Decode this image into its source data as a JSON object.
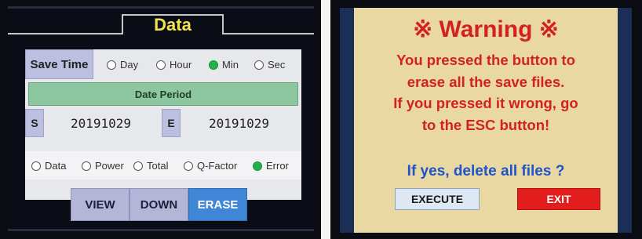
{
  "data_screen": {
    "title": "Data",
    "save_time": {
      "label": "Save Time",
      "options": [
        {
          "label": "Day",
          "selected": false
        },
        {
          "label": "Hour",
          "selected": false
        },
        {
          "label": "Min",
          "selected": true
        },
        {
          "label": "Sec",
          "selected": false
        }
      ]
    },
    "date_period": {
      "label": "Date Period",
      "start_label": "S",
      "start_value": "20191029",
      "end_label": "E",
      "end_value": "20191029"
    },
    "data_type": {
      "options": [
        {
          "label": "Data",
          "selected": false
        },
        {
          "label": "Power",
          "selected": false
        },
        {
          "label": "Total",
          "selected": false
        },
        {
          "label": "Q-Factor",
          "selected": false
        },
        {
          "label": "Error",
          "selected": true
        }
      ]
    },
    "buttons": [
      {
        "label": "VIEW",
        "active": false
      },
      {
        "label": "DOWN",
        "active": false
      },
      {
        "label": "ERASE",
        "active": true
      }
    ]
  },
  "warning_screen": {
    "title": "※ Warning ※",
    "message_lines": [
      "You pressed the button to",
      "erase all the save files.",
      "If you pressed it wrong, go",
      "to the ESC button!"
    ],
    "question": "If yes, delete all files ?",
    "execute_label": "EXECUTE",
    "exit_label": "EXIT"
  },
  "colors": {
    "title_yellow": "#f3e24a",
    "radio_selected_green": "#22b24c",
    "erase_blue": "#3f86d6",
    "warning_red": "#d32121",
    "question_blue": "#1f53c9",
    "exit_red": "#e31c1c"
  }
}
